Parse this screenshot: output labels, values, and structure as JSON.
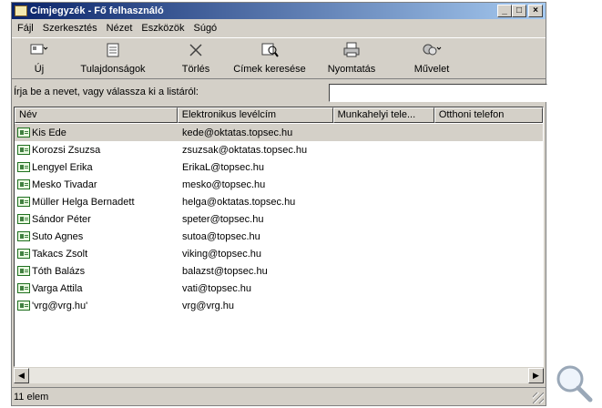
{
  "window": {
    "title": "Címjegyzék - Fő felhasználó",
    "minimize_label": "_",
    "maximize_label": "□",
    "close_label": "×"
  },
  "menu": [
    {
      "label": "Fájl"
    },
    {
      "label": "Szerkesztés"
    },
    {
      "label": "Nézet"
    },
    {
      "label": "Eszközök"
    },
    {
      "label": "Súgó"
    }
  ],
  "toolbar": [
    {
      "label": "Új",
      "icon": "new-contact-icon"
    },
    {
      "label": "Tulajdonságok",
      "icon": "properties-icon"
    },
    {
      "label": "Törlés",
      "icon": "delete-icon"
    },
    {
      "label": "Címek keresése",
      "icon": "find-people-icon"
    },
    {
      "label": "Nyomtatás",
      "icon": "print-icon"
    },
    {
      "label": "Művelet",
      "icon": "action-icon"
    }
  ],
  "find": {
    "label": "Írja be a nevet, vagy válassza ki a listáról:",
    "value": ""
  },
  "columns": [
    "Név",
    "Elektronikus levélcím",
    "Munkahelyi tele...",
    "Otthoni telefon"
  ],
  "contacts": [
    {
      "name": "Kis Ede",
      "email": "kede@oktatas.topsec.hu"
    },
    {
      "name": "Korozsi Zsuzsa",
      "email": "zsuzsak@oktatas.topsec.hu"
    },
    {
      "name": "Lengyel Erika",
      "email": "ErikaL@topsec.hu"
    },
    {
      "name": "Mesko Tivadar",
      "email": "mesko@topsec.hu"
    },
    {
      "name": "Müller Helga Bernadett",
      "email": "helga@oktatas.topsec.hu"
    },
    {
      "name": "Sándor Péter",
      "email": "speter@topsec.hu"
    },
    {
      "name": "Suto Agnes",
      "email": "sutoa@topsec.hu"
    },
    {
      "name": "Takacs Zsolt",
      "email": "viking@topsec.hu"
    },
    {
      "name": "Tóth Balázs",
      "email": "balazst@topsec.hu"
    },
    {
      "name": "Varga Attila",
      "email": "vati@topsec.hu"
    },
    {
      "name": "'vrg@vrg.hu'",
      "email": "vrg@vrg.hu"
    }
  ],
  "selected_index": 0,
  "status": {
    "text": "11 elem"
  },
  "colors": {
    "title_start": "#0a246a",
    "title_end": "#a6caf0",
    "face": "#d4d0c8"
  }
}
